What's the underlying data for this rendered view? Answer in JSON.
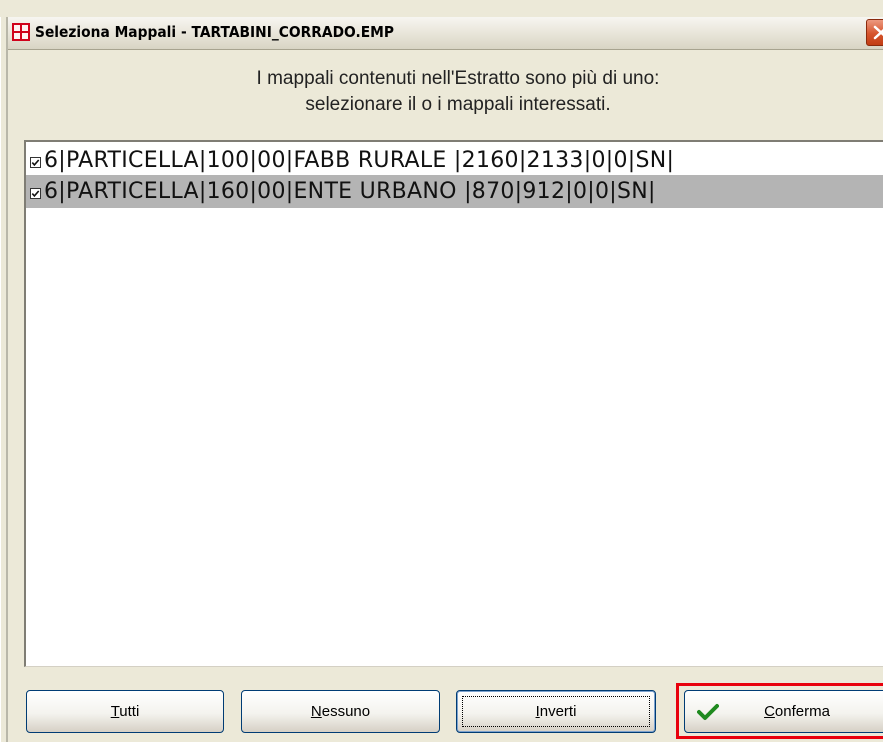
{
  "window": {
    "title": "Seleziona Mappali - TARTABINI_CORRADO.EMP",
    "icon": "app-grid-icon",
    "close_icon": "close-icon"
  },
  "instruction": {
    "line1": "I mappali contenuti nell'Estratto sono più di uno:",
    "line2": "selezionare il o i mappali interessati."
  },
  "list": {
    "items": [
      {
        "label": "6|PARTICELLA|100|00|FABB RURALE |2160|2133|0|0|SN|",
        "checked": true,
        "selected": false
      },
      {
        "label": "6|PARTICELLA|160|00|ENTE URBANO |870|912|0|0|SN|",
        "checked": true,
        "selected": true
      }
    ]
  },
  "buttons": {
    "tutti": {
      "accel": "T",
      "rest": "utti"
    },
    "nessuno": {
      "accel": "N",
      "rest": "essuno"
    },
    "inverti": {
      "accel": "I",
      "rest": "nverti"
    },
    "conferma": {
      "accel": "C",
      "rest": "onferma",
      "icon": "checkmark-icon"
    }
  },
  "colors": {
    "window_bg": "#ece9d8",
    "selection_bg": "#b4b4b4",
    "highlight_border": "#e8000c",
    "confirm_check": "#1f8a1f"
  }
}
